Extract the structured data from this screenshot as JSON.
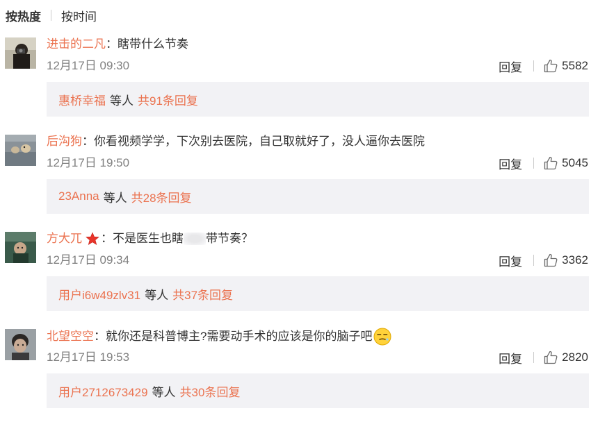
{
  "sort": {
    "hot": "按热度",
    "time": "按时间"
  },
  "comments": [
    {
      "username": "进击的二凡",
      "text": "：瞎带什么节奏",
      "time": "12月17日 09:30",
      "reply_label": "回复",
      "likes": "5582",
      "sub_user": "惠桥幸福",
      "sub_mid": "等人",
      "sub_total": "共91条回复"
    },
    {
      "username": "后沟狗",
      "text": "：你看视频学学，下次别去医院，自己取就好了，没人逼你去医院",
      "time": "12月17日 19:50",
      "reply_label": "回复",
      "likes": "5045",
      "sub_user": "23Anna",
      "sub_mid": "等人",
      "sub_total": "共28条回复"
    },
    {
      "username": "方大兀",
      "text_a": "：不是医生也瞎",
      "text_b": "带节奏？",
      "time": "12月17日 09:34",
      "reply_label": "回复",
      "likes": "3362",
      "sub_user": "用户i6w49zlv31",
      "sub_mid": "等人",
      "sub_total": "共37条回复"
    },
    {
      "username": "北望空空",
      "text": "：就你还是科普博主?需要动手术的应该是你的脑子吧",
      "time": "12月17日 19:53",
      "reply_label": "回复",
      "likes": "2820",
      "sub_user": "用户2712673429",
      "sub_mid": "等人",
      "sub_total": "共30条回复"
    }
  ],
  "colors": {
    "accent": "#eb7350",
    "subbox_bg": "#f2f2f5",
    "meta": "#808080"
  }
}
